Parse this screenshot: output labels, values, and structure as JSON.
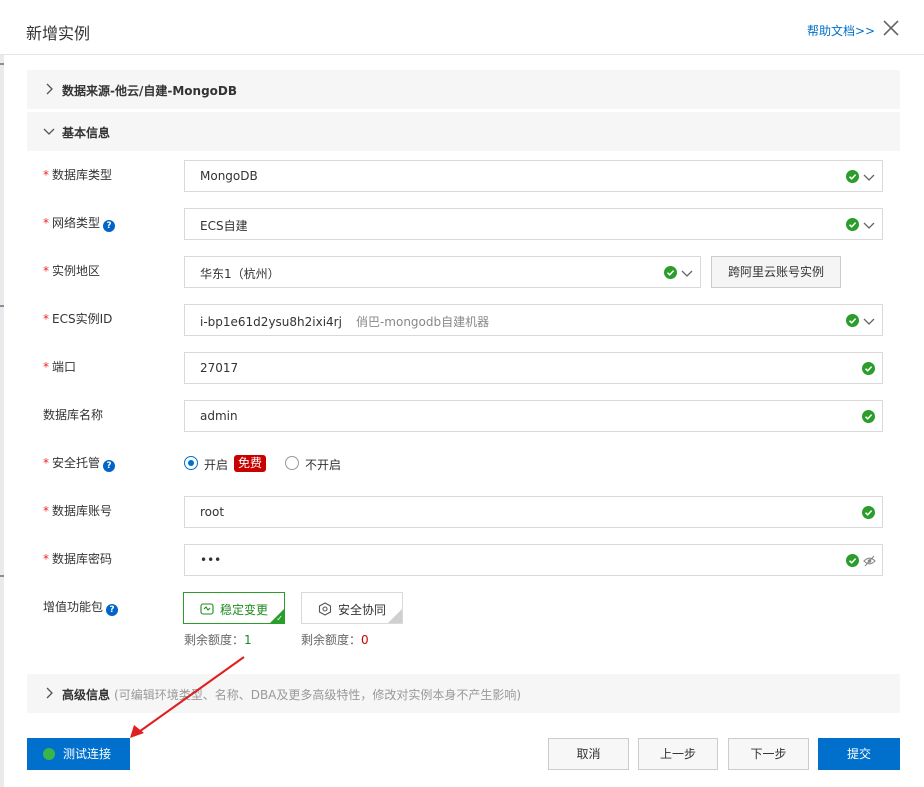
{
  "dialog": {
    "title": "新增实例",
    "help_link": "帮助文档>>",
    "close_icon": "close-icon"
  },
  "sections": {
    "source": {
      "label": "数据来源-他云/自建-MongoDB",
      "expanded": false
    },
    "basic": {
      "label": "基本信息",
      "expanded": true
    },
    "advanced": {
      "label": "高级信息",
      "note": "(可编辑环境类型、名称、DBA及更多高级特性，修改对实例本身不产生影响)",
      "expanded": false
    }
  },
  "fields": {
    "db_type": {
      "label": "数据库类型",
      "required": true,
      "value": "MongoDB"
    },
    "network_type": {
      "label": "网络类型",
      "required": true,
      "value": "ECS自建",
      "help": "?"
    },
    "region": {
      "label": "实例地区",
      "required": true,
      "value": "华东1（杭州）",
      "side_button": "跨阿里云账号实例"
    },
    "ecs_id": {
      "label": "ECS实例ID",
      "required": true,
      "value": "i-bp1e61d2ysu8h2ixi4rj",
      "hint": "俏巴-mongodb自建机器"
    },
    "port": {
      "label": "端口",
      "required": true,
      "value": "27017"
    },
    "db_name": {
      "label": "数据库名称",
      "required": false,
      "value": "admin"
    },
    "security": {
      "label": "安全托管",
      "required": true,
      "help": "?",
      "option_on": "开启",
      "badge": "免费",
      "option_off": "不开启",
      "selected": "开启"
    },
    "account": {
      "label": "数据库账号",
      "required": true,
      "value": "root"
    },
    "password": {
      "label": "数据库密码",
      "required": true,
      "value": "•••"
    },
    "addon": {
      "label": "增值功能包",
      "help": "?",
      "cards": [
        {
          "label": "稳定变更",
          "selected": true,
          "quota_label": "剩余额度：",
          "quota": "1"
        },
        {
          "label": "安全协同",
          "selected": false,
          "quota_label": "剩余额度：",
          "quota": "0"
        }
      ]
    }
  },
  "footer": {
    "test": "测试连接",
    "cancel": "取消",
    "prev": "上一步",
    "next": "下一步",
    "submit": "提交"
  },
  "colors": {
    "primary": "#0070cc",
    "success": "#2a9d2a",
    "required": "#f5222d",
    "badge": "#c80000"
  }
}
